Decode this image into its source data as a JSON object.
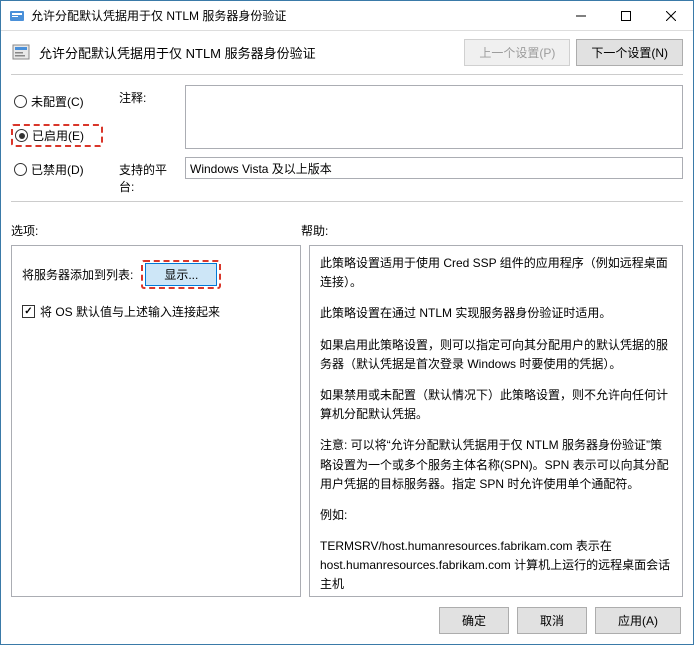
{
  "window": {
    "title": "允许分配默认凭据用于仅 NTLM 服务器身份验证"
  },
  "header": {
    "label": "允许分配默认凭据用于仅 NTLM 服务器身份验证",
    "prev_btn": "上一个设置(P)",
    "next_btn": "下一个设置(N)"
  },
  "radios": {
    "not_configured": "未配置(C)",
    "enabled": "已启用(E)",
    "disabled": "已禁用(D)"
  },
  "fields": {
    "comment_label": "注释:",
    "comment_value": "",
    "platform_label": "支持的平台:",
    "platform_value": "Windows Vista 及以上版本"
  },
  "sections": {
    "options_label": "选项:",
    "help_label": "帮助:"
  },
  "options": {
    "add_servers_label": "将服务器添加到列表:",
    "show_btn": "显示...",
    "checkbox_label": "将 OS 默认值与上述输入连接起来"
  },
  "help": {
    "p1": "此策略设置适用于使用 Cred SSP 组件的应用程序（例如远程桌面连接）。",
    "p2": "此策略设置在通过 NTLM 实现服务器身份验证时适用。",
    "p3": "如果启用此策略设置，则可以指定可向其分配用户的默认凭据的服务器（默认凭据是首次登录 Windows 时要使用的凭据）。",
    "p4": "如果禁用或未配置（默认情况下）此策略设置，则不允许向任何计算机分配默认凭据。",
    "p5": "注意: 可以将“允许分配默认凭据用于仅 NTLM 服务器身份验证”策略设置为一个或多个服务主体名称(SPN)。SPN 表示可以向其分配用户凭据的目标服务器。指定 SPN 时允许使用单个通配符。",
    "p6": "例如:",
    "p7": "TERMSRV/host.humanresources.fabrikam.com 表示在 host.humanresources.fabrikam.com 计算机上运行的远程桌面会话主机"
  },
  "footer": {
    "ok": "确定",
    "cancel": "取消",
    "apply": "应用(A)"
  }
}
